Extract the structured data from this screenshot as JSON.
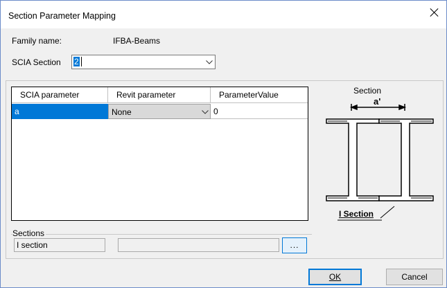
{
  "window": {
    "title": "Section Parameter Mapping"
  },
  "family": {
    "label": "Family name:",
    "value": "IFBA-Beams"
  },
  "scia_section": {
    "label": "SCIA Section",
    "value": "2"
  },
  "grid": {
    "columns": [
      "SCIA parameter",
      "Revit parameter",
      "ParameterValue"
    ],
    "rows": [
      {
        "scia_parameter": "a",
        "revit_parameter": "None",
        "value": "0"
      }
    ]
  },
  "preview": {
    "caption": "Section",
    "dimension_label": "a'",
    "section_label": "I Section"
  },
  "sections": {
    "legend": "Sections",
    "name_value": "I section",
    "second_value": "",
    "browse_label": "..."
  },
  "buttons": {
    "ok": "OK",
    "cancel": "Cancel"
  },
  "colors": {
    "selection": "#0078d7",
    "window_border": "#6b8bc9",
    "button_focus": "#0078d7"
  }
}
